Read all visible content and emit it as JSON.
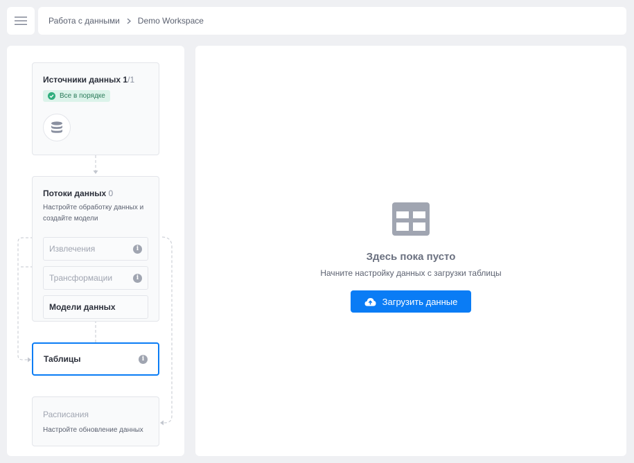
{
  "header": {
    "breadcrumb": [
      {
        "label": "Работа с данными"
      },
      {
        "label": "Demo Workspace"
      }
    ]
  },
  "pipeline": {
    "sources": {
      "title": "Источники данных",
      "count": "1",
      "total": "/1",
      "status": "Все в порядке"
    },
    "flows": {
      "title": "Потоки данных",
      "count": "0",
      "description": "Настройте обработку данных и создайте модели",
      "items": [
        {
          "label": "Извлечения"
        },
        {
          "label": "Трансформации"
        },
        {
          "label": "Модели данных"
        }
      ]
    },
    "tables": {
      "title": "Таблицы"
    },
    "schedules": {
      "title": "Расписания",
      "description": "Настройте обновление данных"
    }
  },
  "empty_state": {
    "title": "Здесь пока пусто",
    "subtitle": "Начните настройку данных с загрузки таблицы",
    "button_label": "Загрузить данные"
  },
  "colors": {
    "accent": "#0a7cf5",
    "success": "#2fae7d",
    "background": "#eff0f3"
  }
}
